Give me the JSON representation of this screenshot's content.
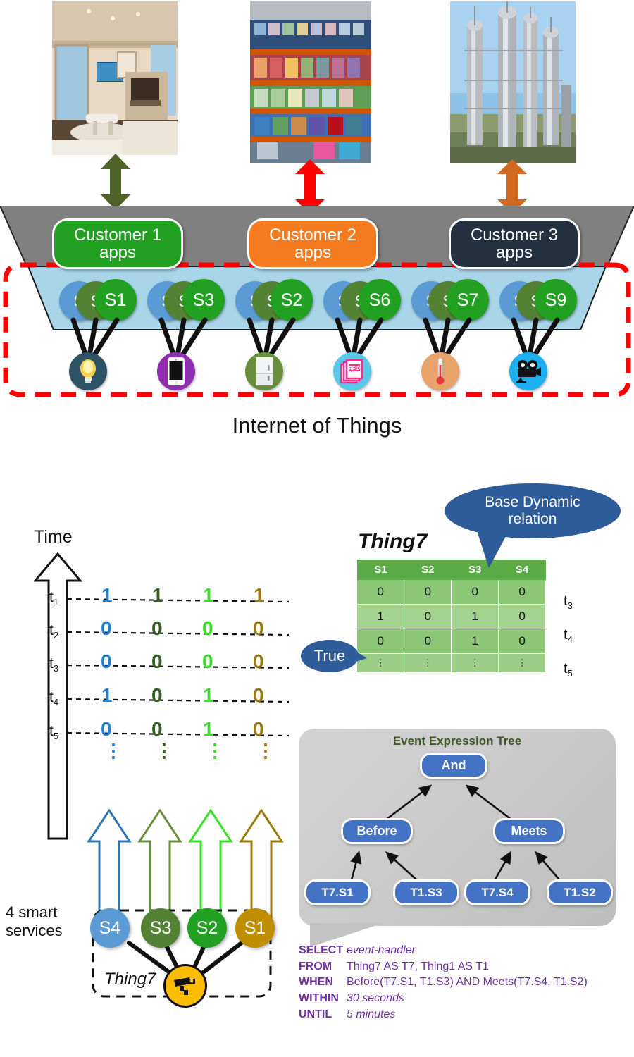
{
  "top_scenes": [
    {
      "name": "smart-home-photo",
      "alt": "smart home living room"
    },
    {
      "name": "retail-store-photo",
      "alt": "retail store shelves"
    },
    {
      "name": "industrial-plant-photo",
      "alt": "industrial refinery towers"
    }
  ],
  "customers": [
    {
      "label": "Customer 1\napps",
      "line1": "Customer 1",
      "line2": "apps",
      "color": "#22a022",
      "arrow_color": "#4f6228"
    },
    {
      "label": "Customer 2\napps",
      "line1": "Customer 2",
      "line2": "apps",
      "color": "#f47b20",
      "arrow_color": "#ff0000"
    },
    {
      "label": "Customer 3\napps",
      "line1": "Customer 3",
      "line2": "apps",
      "color": "#22303f",
      "arrow_color": "#d2691e"
    }
  ],
  "service_clusters": [
    {
      "back": "S",
      "mid": "S",
      "front": "S1"
    },
    {
      "back": "S",
      "mid": "S",
      "front": "S3"
    },
    {
      "back": "S",
      "mid": "S",
      "front": "S2"
    },
    {
      "back": "S",
      "mid": "S",
      "front": "S6"
    },
    {
      "back": "S",
      "mid": "S",
      "front": "S7"
    },
    {
      "back": "S",
      "mid": "S",
      "front": "S9"
    }
  ],
  "sensors": [
    {
      "icon": "lightbulb-icon",
      "bg": "#2e5266"
    },
    {
      "icon": "smartphone-icon",
      "bg": "#8e2fb0"
    },
    {
      "icon": "appliance-icon",
      "bg": "#6a8f3c"
    },
    {
      "icon": "rfid-tag-icon",
      "bg": "#5ac8e8"
    },
    {
      "icon": "thermometer-icon",
      "bg": "#e8a36b"
    },
    {
      "icon": "camera-icon",
      "bg": "#1eb0ee"
    }
  ],
  "iot_caption": "Internet of Things",
  "timeline": {
    "axis_label": "Time",
    "time_labels": [
      "t",
      "t",
      "t",
      "t",
      "t"
    ],
    "time_subs": [
      "1",
      "2",
      "3",
      "4",
      "5"
    ],
    "columns": [
      {
        "color": "#1f7fd4",
        "values": [
          "1",
          "0",
          "0",
          "1",
          "0"
        ]
      },
      {
        "color": "#375f23",
        "values": [
          "1",
          "0",
          "0",
          "0",
          "0"
        ]
      },
      {
        "color": "#37e024",
        "values": [
          "1",
          "0",
          "0",
          "1",
          "1"
        ]
      },
      {
        "color": "#9d7a0d",
        "values": [
          "1",
          "0",
          "0",
          "0",
          "0"
        ]
      }
    ],
    "continuation": "⋮"
  },
  "smart_services": {
    "label_line1": "4 smart",
    "label_line2": "services",
    "nodes": [
      {
        "label": "S4",
        "color": "#5b9bd5",
        "arrow_color": "#2e75b6"
      },
      {
        "label": "S3",
        "color": "#548235",
        "arrow_color": "#6a8f3c"
      },
      {
        "label": "S2",
        "color": "#22a022",
        "arrow_color": "#37e024"
      },
      {
        "label": "S1",
        "color": "#bf8f00",
        "arrow_color": "#9d7a0d"
      }
    ],
    "thing_label": "Thing7",
    "thing_icon": "cctv-camera-icon",
    "thing_color": "#fbbc04"
  },
  "thing7_table": {
    "title": "Thing7",
    "columns": [
      "S1",
      "S2",
      "S3",
      "S4"
    ],
    "rows": [
      {
        "values": [
          "0",
          "0",
          "0",
          "0"
        ],
        "time": "t",
        "time_sub": "3"
      },
      {
        "values": [
          "1",
          "0",
          "1",
          "0"
        ],
        "time": "t",
        "time_sub": "4"
      },
      {
        "values": [
          "0",
          "0",
          "1",
          "0"
        ],
        "time": "t",
        "time_sub": "5"
      },
      {
        "values": [
          "⋮",
          "⋮",
          "⋮",
          "⋮"
        ],
        "time": "",
        "time_sub": ""
      }
    ],
    "header_color": "#5aab46"
  },
  "callouts": {
    "base_dynamic": "Base Dynamic relation",
    "base_dynamic_line1": "Base Dynamic",
    "base_dynamic_line2": "relation",
    "true_label": "True",
    "bubble_color": "#2e5b9a"
  },
  "event_tree": {
    "title": "Event Expression Tree",
    "root": "And",
    "internal": [
      "Before",
      "Meets"
    ],
    "leaves": [
      "T7.S1",
      "T1.S3",
      "T7.S4",
      "T1.S2"
    ],
    "node_color": "#4472c4"
  },
  "sql": {
    "lines": [
      {
        "kw": "SELECT",
        "rest": "event-handler",
        "italic": true
      },
      {
        "kw": "FROM",
        "rest": "Thing7 AS T7, Thing1 AS T1",
        "italic": false
      },
      {
        "kw": "WHEN",
        "rest": "Before(T7.S1, T1.S3) AND Meets(T7.S4, T1.S2)",
        "italic": false
      },
      {
        "kw": "WITHIN",
        "rest": "30 seconds",
        "italic": true
      },
      {
        "kw": "UNTIL",
        "rest": "5 minutes",
        "italic": true
      }
    ],
    "color": "#7030a0"
  }
}
